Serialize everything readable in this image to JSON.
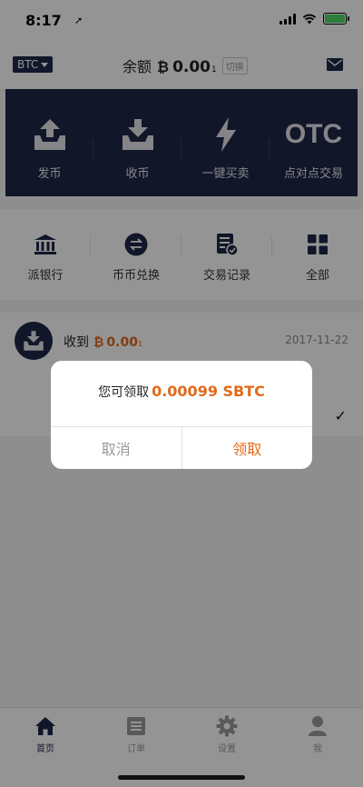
{
  "status_bar": {
    "time": "8:17",
    "location_arrow": "➚"
  },
  "header": {
    "coin_selector": "BTC",
    "balance_label": "余额",
    "btc_symbol": "₿",
    "balance_amount": "0.00",
    "balance_suffix": "1",
    "switch_label": "切换"
  },
  "main_actions": [
    {
      "label": "发币",
      "icon": "send-tray-icon"
    },
    {
      "label": "收币",
      "icon": "receive-tray-icon"
    },
    {
      "label": "一键买卖",
      "icon": "lightning-icon"
    },
    {
      "label": "点对点交易",
      "icon_text": "OTC"
    }
  ],
  "quick_actions": [
    {
      "label": "派银行",
      "icon": "bank-icon"
    },
    {
      "label": "币币兑换",
      "icon": "exchange-icon"
    },
    {
      "label": "交易记录",
      "icon": "record-icon"
    },
    {
      "label": "全部",
      "icon": "grid-icon"
    }
  ],
  "record": {
    "title": "收到",
    "btc_symbol": "₿",
    "amount": "0.00",
    "amount_suffix": "1",
    "date": "2017-11-22",
    "check": "✓"
  },
  "dialog": {
    "message": "您可领取",
    "value": "0.00099 SBTC",
    "cancel": "取消",
    "confirm": "领取"
  },
  "tabs": [
    {
      "label": "首页",
      "active": true
    },
    {
      "label": "订单"
    },
    {
      "label": "设置"
    },
    {
      "label": "我"
    }
  ],
  "colors": {
    "navy": "#1e2647",
    "accent": "#e06a1a"
  }
}
